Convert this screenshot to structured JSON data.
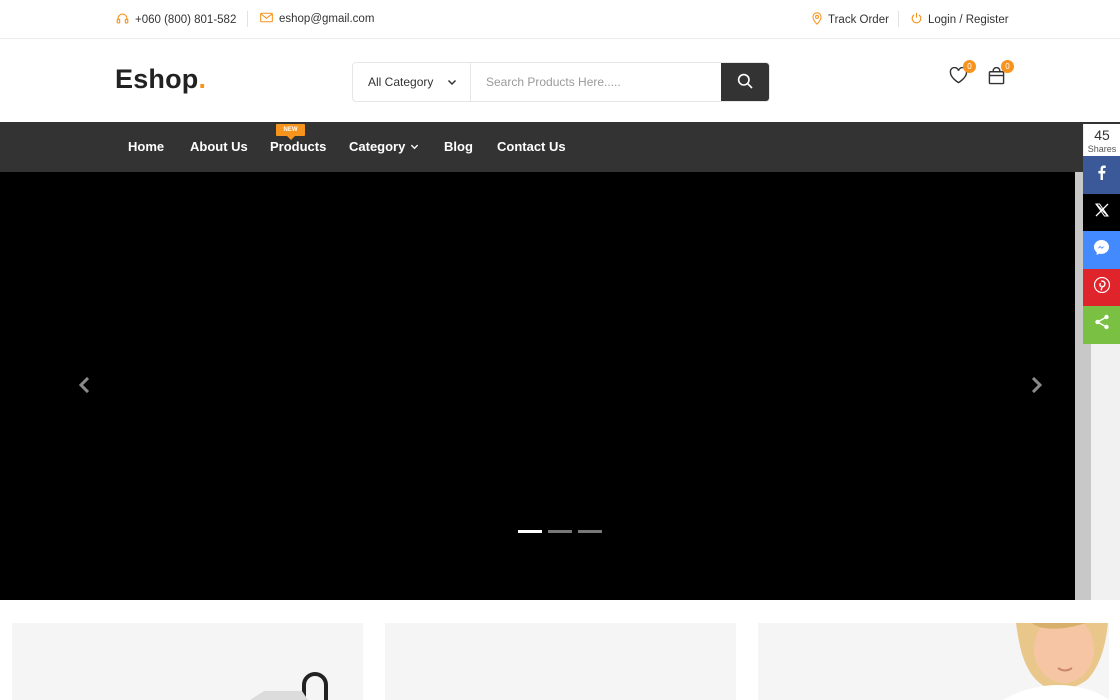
{
  "topbar": {
    "phone": "+060 (800) 801-582",
    "email": "eshop@gmail.com",
    "track_order": "Track Order",
    "login_register": "Login / Register"
  },
  "header": {
    "logo_text": "Eshop",
    "logo_dot": ".",
    "category_select": "All Category",
    "search_placeholder": "Search Products Here.....",
    "wishlist_count": "0",
    "cart_count": "0"
  },
  "nav": {
    "items": [
      {
        "label": "Home"
      },
      {
        "label": "About Us"
      },
      {
        "label": "Products",
        "badge": "NEW"
      },
      {
        "label": "Category"
      },
      {
        "label": "Blog"
      },
      {
        "label": "Contact Us"
      }
    ]
  },
  "hero": {
    "slide_count": 3,
    "active_slide": 1
  },
  "share": {
    "count": "45",
    "label": "Shares",
    "buttons": [
      {
        "name": "facebook",
        "color": "#3b5998"
      },
      {
        "name": "x-twitter",
        "color": "#000000"
      },
      {
        "name": "messenger",
        "color": "#448aff"
      },
      {
        "name": "pinterest",
        "color": "#e0242c"
      },
      {
        "name": "share",
        "color": "#7ac143"
      }
    ]
  },
  "colors": {
    "accent": "#f7941d",
    "nav_bg": "#333333",
    "hero_bg": "#000000"
  }
}
